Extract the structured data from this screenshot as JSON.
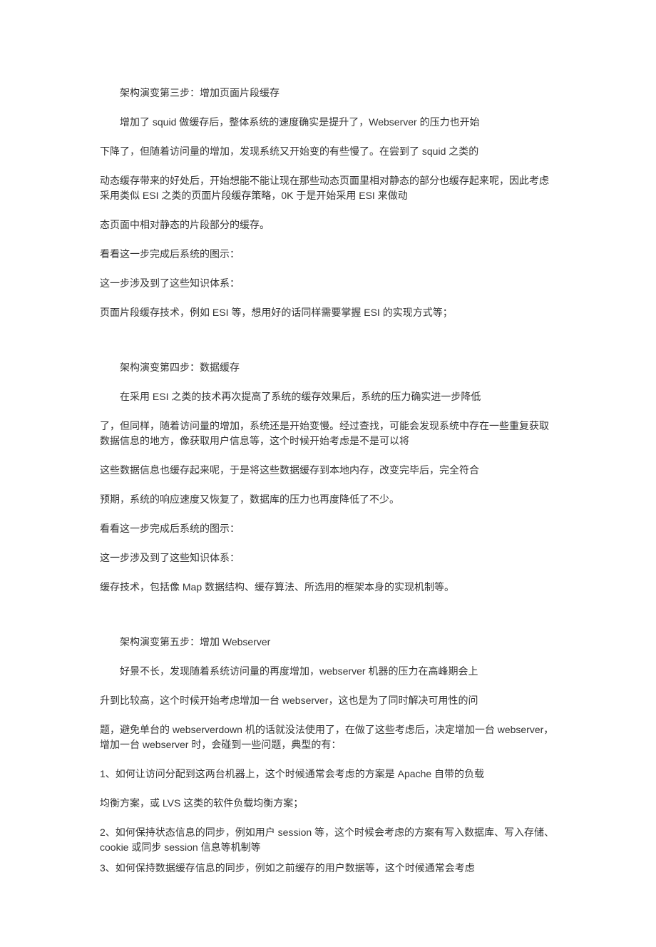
{
  "section3": {
    "title": "架构演变第三步：增加页面片段缓存",
    "p1": "增加了 squid 做缓存后，整体系统的速度确实是提升了，Webserver 的压力也开始",
    "p2": "下降了，但随着访问量的增加，发现系统又开始变的有些慢了。在尝到了 squid 之类的",
    "p3": "动态缓存带来的好处后，开始想能不能让现在那些动态页面里相对静态的部分也缓存起来呢，因此考虑采用类似 ESI 之类的页面片段缓存策略，0K 于是开始采用 ESI 来做动",
    "p4": "态页面中相对静态的片段部分的缓存。",
    "p5": "看看这一步完成后系统的图示：",
    "p6": "这一步涉及到了这些知识体系：",
    "p7": "页面片段缓存技术，例如 ESI 等，想用好的话同样需要掌握 ESI 的实现方式等；"
  },
  "section4": {
    "title": "架构演变第四步：数据缓存",
    "p1": "在采用 ESI 之类的技术再次提高了系统的缓存效果后，系统的压力确实进一步降低",
    "p2": "了，但同样，随着访问量的增加，系统还是开始变慢。经过查找，可能会发现系统中存在一些重复获取数据信息的地方，像获取用户信息等，这个时候开始考虑是不是可以将",
    "p3": "这些数据信息也缓存起来呢，于是将这些数据缓存到本地内存，改变完毕后，完全符合",
    "p4": "预期，系统的响应速度又恢复了，数据库的压力也再度降低了不少。",
    "p5": "看看这一步完成后系统的图示：",
    "p6": "这一步涉及到了这些知识体系：",
    "p7": "缓存技术，包括像 Map 数据结构、缓存算法、所选用的框架本身的实现机制等。"
  },
  "section5": {
    "title": "架构演变第五步：增加 Webserver",
    "p1": "好景不长，发现随着系统访问量的再度增加，webserver 机器的压力在高峰期会上",
    "p2": "升到比较高，这个时候开始考虑增加一台 webserver，这也是为了同时解决可用性的问",
    "p3": "题，避免单台的 webserverdown 机的话就没法使用了，在做了这些考虑后，决定增加一台 webserver，增加一台 webserver 时，会碰到一些问题，典型的有：",
    "p4": "1、如何让访问分配到这两台机器上，这个时候通常会考虑的方案是 Apache 自带的负载",
    "p5": "均衡方案，或 LVS 这类的软件负载均衡方案；",
    "p6": "2、如何保持状态信息的同步，例如用户 session 等，这个时候会考虑的方案有写入数据库、写入存储、cookie 或同步 session 信息等机制等",
    "p7": "3、如何保持数据缓存信息的同步，例如之前缓存的用户数据等，这个时候通常会考虑"
  }
}
